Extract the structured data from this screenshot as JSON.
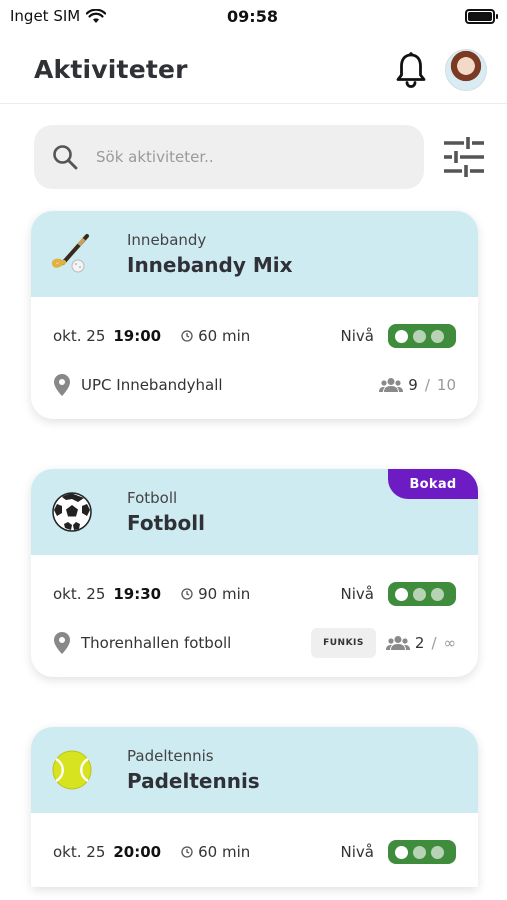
{
  "status_bar": {
    "carrier": "Inget SIM",
    "time": "09:58"
  },
  "header": {
    "title": "Aktiviteter"
  },
  "search": {
    "placeholder": "Sök aktiviteter.."
  },
  "activities": [
    {
      "category": "Innebandy",
      "name": "Innebandy Mix",
      "icon": "floorball-stick-icon",
      "date": "okt. 25",
      "time": "19:00",
      "duration": "60 min",
      "level_label": "Nivå",
      "level": 1,
      "level_max": 3,
      "location": "UPC Innebandyhall",
      "tag": "",
      "participants": "9",
      "separator": "/",
      "max_participants": "10",
      "badge": ""
    },
    {
      "category": "Fotboll",
      "name": "Fotboll",
      "icon": "soccer-ball-icon",
      "date": "okt. 25",
      "time": "19:30",
      "duration": "90 min",
      "level_label": "Nivå",
      "level": 1,
      "level_max": 3,
      "location": "Thorenhallen fotboll",
      "tag": "FUNKIS",
      "participants": "2",
      "separator": "/",
      "max_participants": "∞",
      "badge": "Bokad"
    },
    {
      "category": "Padeltennis",
      "name": "Padeltennis",
      "icon": "tennis-ball-icon",
      "date": "okt. 25",
      "time": "20:00",
      "duration": "60 min",
      "level_label": "Nivå",
      "level": 1,
      "level_max": 3,
      "badge": ""
    }
  ],
  "colors": {
    "card_header": "#cdebf0",
    "level_pill": "#3f8d3c",
    "badge": "#6d1cc4",
    "search_bg": "#efefef"
  }
}
